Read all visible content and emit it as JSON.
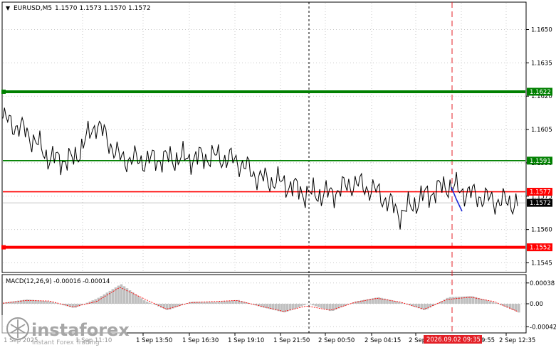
{
  "header": {
    "menu_arrow": "▼",
    "symbol": "EURUSD,M5",
    "ohlc": "1.1570 1.1573 1.1570 1.1572"
  },
  "main_price_axis": {
    "ticks": [
      "1.1650",
      "1.1635",
      "1.1620",
      "1.1605",
      "1.1590",
      "1.1575",
      "1.1560",
      "1.1545"
    ],
    "tick_values": [
      1.165,
      1.1635,
      1.162,
      1.1605,
      1.159,
      1.1575,
      1.156,
      1.1545
    ]
  },
  "levels": [
    {
      "label": "1.1622",
      "value": 1.1622,
      "color": "#008000",
      "weight": "thick"
    },
    {
      "label": "1.1591",
      "value": 1.1591,
      "color": "#008000",
      "weight": "thin"
    },
    {
      "label": "1.1577",
      "value": 1.1577,
      "color": "#ff0000",
      "weight": "thin"
    },
    {
      "label": "1.1552",
      "value": 1.1552,
      "color": "#ff0000",
      "weight": "thick"
    }
  ],
  "current_price": {
    "label": "1.1572",
    "value": 1.1572
  },
  "macd": {
    "title": "MACD(12,26,9) -0.00016 -0.00014",
    "ticks": [
      "0.00038",
      "0.00",
      "-0.00042"
    ],
    "tick_values": [
      0.00038,
      0.0,
      -0.00042
    ],
    "histogram_color": "#c0c0c0",
    "signal_color": "#ff0000"
  },
  "time_axis": {
    "labels": [
      "1 Sep 2025",
      "1 Sep 11:10",
      "1 Sep 13:50",
      "1 Sep 16:30",
      "1 Sep 19:10",
      "1 Sep 21:50",
      "2 Sep 00:50",
      "2 Sep 04:15",
      "2 Sep 06:55",
      "2 Sep 09:55",
      "2 Sep 12:35"
    ],
    "cursor_label": "2026.09.02 09:35"
  },
  "watermark": {
    "brand": "instaforex",
    "tagline": "Instant Forex Trading"
  },
  "chart_data": {
    "type": "line",
    "symbol": "EURUSD",
    "timeframe": "M5",
    "ylim": [
      1.1541,
      1.1662
    ],
    "x": [
      "1 Sep 2025",
      "1 Sep 11:10",
      "1 Sep 13:50",
      "1 Sep 16:30",
      "1 Sep 19:10",
      "1 Sep 21:50",
      "2 Sep 00:50",
      "2 Sep 04:15",
      "2 Sep 06:55",
      "2 Sep 09:55",
      "2 Sep 12:35"
    ],
    "price": [
      1.161,
      1.1604,
      1.1592,
      1.1591,
      1.1608,
      1.1592,
      1.1591,
      1.1592,
      1.1592,
      1.1593,
      1.1591,
      1.1583,
      1.1581,
      1.1576,
      1.1576,
      1.1581,
      1.1577,
      1.1567,
      1.1575,
      1.158,
      1.1576,
      1.1573,
      1.1572
    ],
    "macd_histogram": [
      2e-05,
      8e-05,
      4e-05,
      -8e-05,
      0.0001,
      0.00036,
      6e-05,
      -0.00012,
      4e-05,
      3e-05,
      7e-05,
      -6e-05,
      -0.00016,
      0.0,
      -0.00014,
      4e-05,
      0.00012,
      2e-05,
      -0.00012,
      0.00012,
      0.00014,
      2e-05,
      -0.00016
    ],
    "macd_signal": [
      1e-05,
      6e-05,
      5e-05,
      -6e-05,
      4e-05,
      0.0003,
      0.0001,
      -0.0001,
      2e-05,
      4e-05,
      6e-05,
      -4e-05,
      -0.00014,
      -4e-05,
      -0.00012,
      2e-05,
      0.0001,
      3e-05,
      -0.0001,
      8e-05,
      0.00012,
      4e-05,
      -0.00014
    ]
  }
}
